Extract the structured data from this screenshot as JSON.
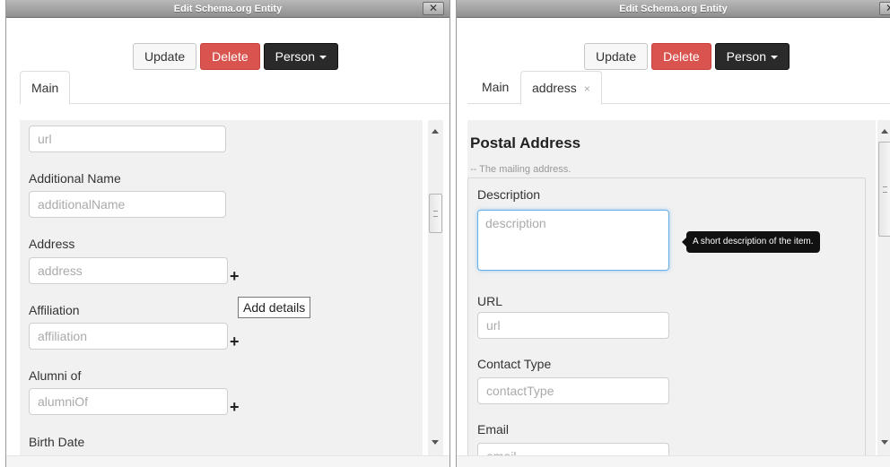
{
  "left_dialog": {
    "title": "Edit Schema.org Entity",
    "close_glyph": "✕",
    "buttons": {
      "update": "Update",
      "delete": "Delete",
      "type": "Person"
    },
    "tabs": [
      {
        "label": "Main"
      }
    ],
    "form": {
      "url": {
        "placeholder": "url"
      },
      "additional_name": {
        "label": "Additional Name",
        "placeholder": "additionalName"
      },
      "address": {
        "label": "Address",
        "placeholder": "address"
      },
      "affiliation": {
        "label": "Affiliation",
        "placeholder": "affiliation"
      },
      "alumni_of": {
        "label": "Alumni of",
        "placeholder": "alumniOf"
      },
      "birth_date": {
        "label": "Birth Date"
      }
    },
    "plus_glyph": "+",
    "tooltip": "Add details"
  },
  "right_dialog": {
    "title": "Edit Schema.org Entity",
    "close_glyph": "✕",
    "buttons": {
      "update": "Update",
      "delete": "Delete",
      "type": "Person"
    },
    "tabs": [
      {
        "label": "Main"
      },
      {
        "label": "address",
        "close": "×"
      }
    ],
    "section": {
      "heading": "Postal Address",
      "subtitle": "-- The mailing address.",
      "description": {
        "label": "Description",
        "placeholder": "description",
        "tooltip": "A short description of the item."
      },
      "url": {
        "label": "URL",
        "placeholder": "url"
      },
      "contact_type": {
        "label": "Contact Type",
        "placeholder": "contactType"
      },
      "email": {
        "label": "Email",
        "placeholder": "email"
      }
    }
  },
  "colors": {
    "danger": "#d9534f",
    "inverse": "#2a2a2a",
    "focus": "#66afe9"
  }
}
